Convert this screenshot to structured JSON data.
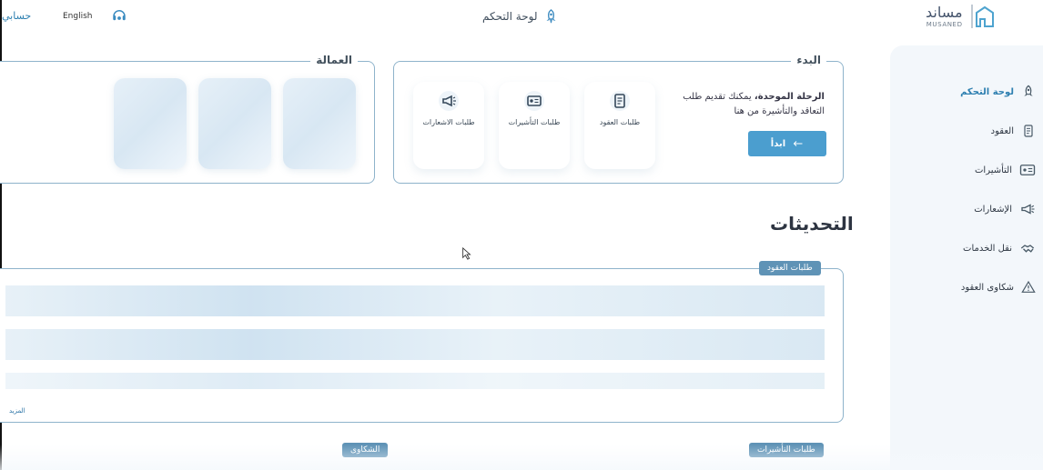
{
  "header": {
    "account_label": "حسابي",
    "language_label": "English",
    "page_title": "لوحة التحكم",
    "logo_ar": "مساند",
    "logo_en": "MUSANED"
  },
  "sidebar": {
    "items": [
      {
        "label": "لوحة التحكم",
        "icon": "rocket-icon",
        "active": true
      },
      {
        "label": "العقود",
        "icon": "document-icon",
        "active": false
      },
      {
        "label": "التأشيرات",
        "icon": "id-card-icon",
        "active": false
      },
      {
        "label": "الإشعارات",
        "icon": "megaphone-icon",
        "active": false
      },
      {
        "label": "نقل الخدمات",
        "icon": "handshake-icon",
        "active": false
      },
      {
        "label": "شكاوى العقود",
        "icon": "warning-icon",
        "active": false
      }
    ]
  },
  "start_section": {
    "title": "البدء",
    "message_bold": "الرحلة الموحدة،",
    "message_rest": "يمكنك تقديم طلب التعاقد والتأشيرة من هنا",
    "button_label": "ابدأ",
    "tiles": [
      {
        "label": "طلبات العقود",
        "icon": "document-icon"
      },
      {
        "label": "طلبات التأشيرات",
        "icon": "id-card-icon"
      },
      {
        "label": "طلبات الاشعارات",
        "icon": "megaphone-icon"
      }
    ]
  },
  "workers_section": {
    "title": "العمالة"
  },
  "updates": {
    "title": "التحديثات",
    "tab_label": "طلبات العقود",
    "more_label": "المزيد"
  },
  "bottom": {
    "complaints_label": "الشكاوى",
    "visas_label": "طلبات التأشيرات"
  },
  "colors": {
    "accent": "#4b9ecf",
    "pill": "#5f93b6",
    "card_border": "#8eb3cb",
    "sidebar_bg": "#f3f7fb"
  }
}
